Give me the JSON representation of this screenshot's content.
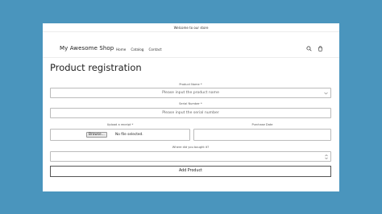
{
  "announcement": "Welcome to our store",
  "header": {
    "logo": "My Awesome Shop",
    "nav": [
      "Home",
      "Catalog",
      "Contact"
    ],
    "icons": [
      "search-icon",
      "cart-icon"
    ]
  },
  "page_title": "Product registration",
  "form": {
    "product_name": {
      "label": "Product Name *",
      "value": "Please input the product name"
    },
    "serial_number": {
      "label": "Serial Number *",
      "placeholder": "Please input the serial number"
    },
    "receipt": {
      "label": "Upload a receipt *",
      "button": "Browse...",
      "status": "No file selected."
    },
    "purchase_date": {
      "label": "Purchase Date",
      "value": ""
    },
    "where_bought": {
      "label": "Where did you bought it?",
      "value": ""
    },
    "submit": "Add Product"
  }
}
